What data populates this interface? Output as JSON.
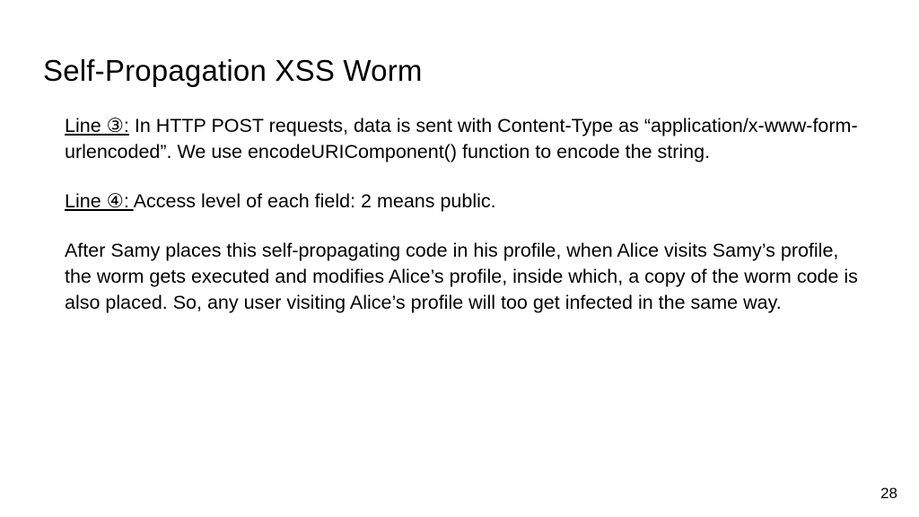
{
  "title": "Self-Propagation XSS Worm",
  "para1": {
    "lead": "Line ③:",
    "text": " In HTTP POST requests, data is sent with Content-Type as “application/x-www-form-urlencoded”. We use encodeURIComponent() function to encode the string."
  },
  "para2": {
    "lead": "Line ④: ",
    "text": " Access level of each field: 2 means public."
  },
  "para3": {
    "text": "After Samy places this self-propagating code in his profile, when Alice visits Samy’s profile, the worm gets executed and modifies Alice’s profile, inside which, a copy of the worm code is also placed. So, any user visiting Alice’s profile will too get infected in the same way."
  },
  "page_number": "28"
}
